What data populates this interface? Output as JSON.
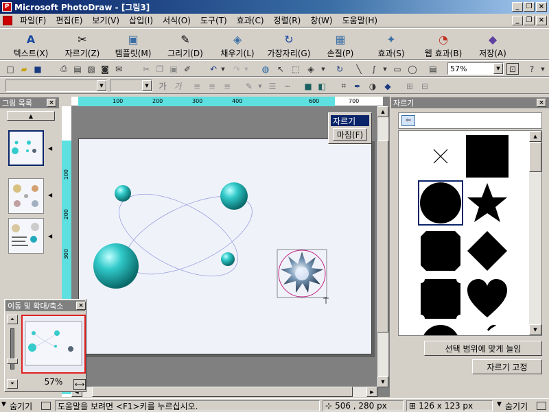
{
  "window": {
    "title": "Microsoft PhotoDraw - [그림3]"
  },
  "menu": [
    "파일(F)",
    "편집(E)",
    "보기(V)",
    "삽입(I)",
    "서식(O)",
    "도구(T)",
    "효과(C)",
    "정렬(R)",
    "창(W)",
    "도움말(H)"
  ],
  "big_toolbar": [
    {
      "label": "텍스트(X)",
      "icon": "A"
    },
    {
      "label": "자르기(Z)",
      "icon": "✂"
    },
    {
      "label": "템플릿(M)",
      "icon": "▣"
    },
    {
      "label": "그리기(D)",
      "icon": "✎"
    },
    {
      "label": "채우기(L)",
      "icon": "◈"
    },
    {
      "label": "가장자리(G)",
      "icon": "↻"
    },
    {
      "label": "손질(P)",
      "icon": "▦"
    },
    {
      "label": "효과(S)",
      "icon": "✦"
    },
    {
      "label": "웹 효과(B)",
      "icon": "◔"
    },
    {
      "label": "저장(A)",
      "icon": "◆"
    }
  ],
  "zoom": "57%",
  "format_bar": {
    "bold": "가",
    "italic": "가"
  },
  "picture_list": {
    "title": "그림 목록"
  },
  "popup": {
    "items": [
      "자르기",
      "마침(F)"
    ]
  },
  "ruler": {
    "h_ticks": [
      "100",
      "200",
      "300",
      "400",
      "600",
      "700"
    ],
    "v_ticks": [
      "100",
      "200",
      "300"
    ]
  },
  "right_panel": {
    "title": "자르기",
    "fit_button": "선택 범위에 맞게 늘임",
    "fix_button": "자르기 고정"
  },
  "nav_panel": {
    "title": "이동 및 확대/축소",
    "zoom": "57%"
  },
  "status": {
    "hide_left": "숨기기",
    "help": "도움말을 보려면 <F1>키를 누르십시오.",
    "position": "506 , 280  px",
    "size": "126 x 123  px",
    "hide_right": "숨기기"
  }
}
